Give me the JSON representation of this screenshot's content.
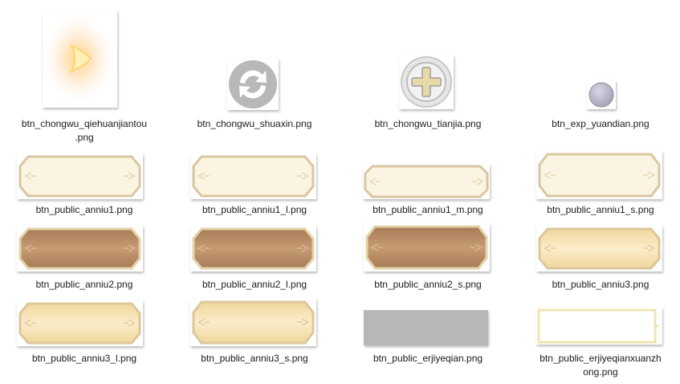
{
  "files": [
    {
      "name": "btn_chongwu_qiehuanjiantou\n.png",
      "icon": "orange-glow-arrow-icon"
    },
    {
      "name": "btn_chongwu_shuaxin.png",
      "icon": "refresh-icon"
    },
    {
      "name": "btn_chongwu_tianjia.png",
      "icon": "plus-icon"
    },
    {
      "name": "btn_exp_yuandian.png",
      "icon": "grey-dot-icon"
    },
    {
      "name": "btn_public_anniu1.png",
      "icon": "cream-button-icon"
    },
    {
      "name": "btn_public_anniu1_l.png",
      "icon": "cream-button-icon"
    },
    {
      "name": "btn_public_anniu1_m.png",
      "icon": "cream-button-icon"
    },
    {
      "name": "btn_public_anniu1_s.png",
      "icon": "cream-button-icon"
    },
    {
      "name": "btn_public_anniu2.png",
      "icon": "brown-button-icon"
    },
    {
      "name": "btn_public_anniu2_l.png",
      "icon": "brown-button-icon"
    },
    {
      "name": "btn_public_anniu2_s.png",
      "icon": "brown-button-icon"
    },
    {
      "name": "btn_public_anniu3.png",
      "icon": "gold-button-icon"
    },
    {
      "name": "btn_public_anniu3_l.png",
      "icon": "gold-button-icon"
    },
    {
      "name": "btn_public_anniu3_s.png",
      "icon": "gold-button-icon"
    },
    {
      "name": "btn_public_erjiyeqian.png",
      "icon": "grey-tab-icon"
    },
    {
      "name": "btn_public_erjiyeqianxuanzh\nong.png",
      "icon": "white-tab-icon"
    }
  ],
  "colors": {
    "cream_fill": "#fbf4e2",
    "cream_border": "#d9c6a2",
    "brown_fill": "#b98a63",
    "gold_fill": "#f5e0ae",
    "grey_tab": "#b7b7b8",
    "refresh_grey": "#b8b8b8",
    "plus_gold": "#e8d9a8"
  }
}
